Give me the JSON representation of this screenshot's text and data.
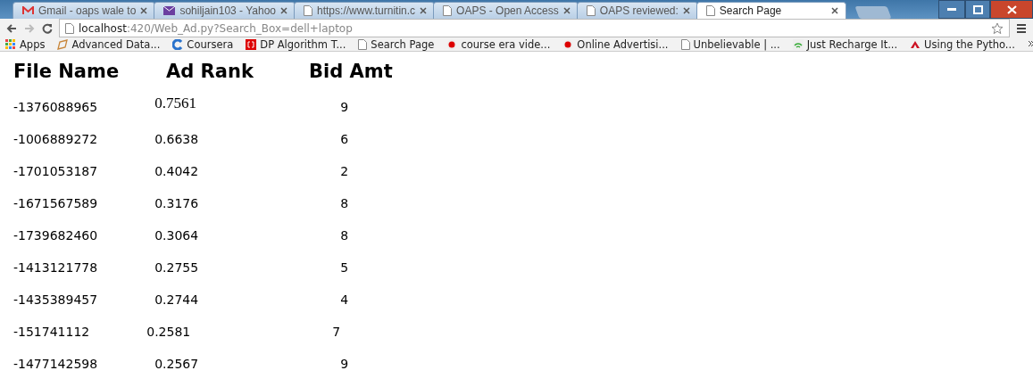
{
  "tabs": [
    {
      "title": "Gmail - oaps wale to",
      "kind": "gmail",
      "selected": false
    },
    {
      "title": "sohiljain103 - Yahoo",
      "kind": "mail",
      "selected": false
    },
    {
      "title": "https://www.turnitin.c",
      "kind": "page",
      "selected": false
    },
    {
      "title": "OAPS - Open Access",
      "kind": "page",
      "selected": false
    },
    {
      "title": "OAPS reviewed:",
      "kind": "page",
      "selected": false
    },
    {
      "title": "Search Page",
      "kind": "page",
      "selected": true
    }
  ],
  "address": {
    "host": "localhost",
    "rest": ":420/Web_Ad.py?Search_Box=dell+laptop"
  },
  "bookmarks": [
    {
      "label": "Apps",
      "kind": "apps"
    },
    {
      "label": "Advanced Data...",
      "kind": "chart"
    },
    {
      "label": "Coursera",
      "kind": "coursera"
    },
    {
      "label": "DP Algorithm T...",
      "kind": "bracket"
    },
    {
      "label": "Search Page",
      "kind": "page"
    },
    {
      "label": "course era vide...",
      "kind": "record"
    },
    {
      "label": "Online Advertisi...",
      "kind": "record"
    },
    {
      "label": "Unbelievable | ...",
      "kind": "page"
    },
    {
      "label": "Just Recharge It...",
      "kind": "wifi"
    },
    {
      "label": "Using the Pytho...",
      "kind": "triangle"
    }
  ],
  "table": {
    "columns": [
      "File Name",
      "Ad Rank",
      "Bid Amt"
    ],
    "rows": [
      {
        "file": "-1376088965",
        "rank": "0.7561",
        "bid": "9",
        "kind": "serif"
      },
      {
        "file": "-1006889272",
        "rank": "0.6638",
        "bid": "6",
        "kind": "plain"
      },
      {
        "file": "-1701053187",
        "rank": "0.4042",
        "bid": "2",
        "kind": "plain"
      },
      {
        "file": "-1671567589",
        "rank": "0.3176",
        "bid": "8",
        "kind": "plain"
      },
      {
        "file": "-1739682460",
        "rank": "0.3064",
        "bid": "8",
        "kind": "plain"
      },
      {
        "file": "-1413121778",
        "rank": "0.2755",
        "bid": "5",
        "kind": "plain"
      },
      {
        "file": "-1435389457",
        "rank": "0.2744",
        "bid": "4",
        "kind": "plain"
      },
      {
        "file": "-151741112",
        "rank": "0.2581",
        "bid": "7",
        "kind": "plain"
      },
      {
        "file": "-1477142598",
        "rank": "0.2567",
        "bid": "9",
        "kind": "plain"
      }
    ]
  }
}
